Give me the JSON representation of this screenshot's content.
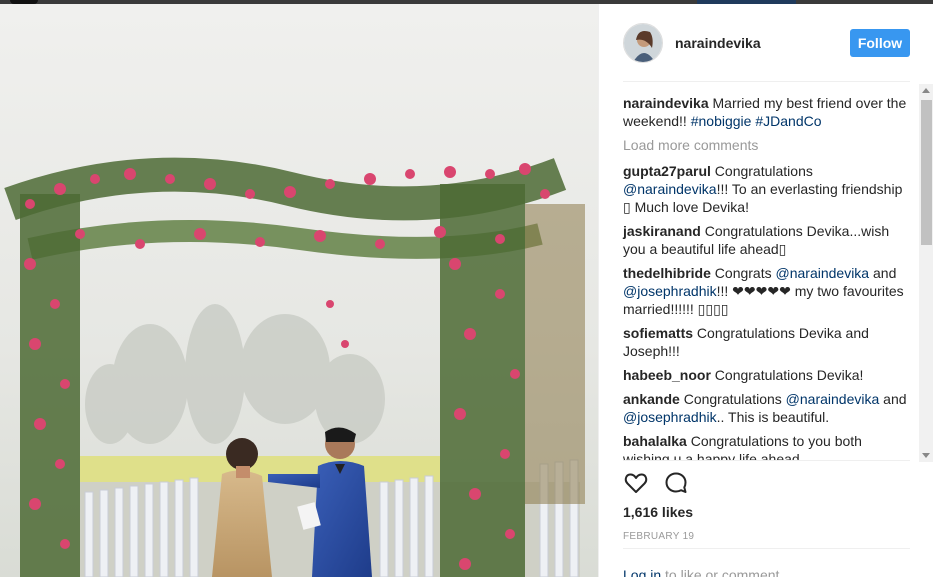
{
  "post": {
    "username": "naraindevika",
    "follow_label": "Follow",
    "caption_user": "naraindevika",
    "caption_text": " Married my best friend over the weekend!! ",
    "caption_tag1": "#nobiggie",
    "caption_tag2": "#JDandCo",
    "load_more": "Load more comments",
    "likes": "1,616 likes",
    "date": "FEBRUARY 19",
    "login_link": "Log in",
    "login_rest": " to like or comment.",
    "more_dots": "..."
  },
  "comments": [
    {
      "user": "gupta27parul",
      "parts": [
        " Congratulations ",
        "@naraindevika",
        "!!! To an everlasting friendship ▯ Much love Devika!"
      ]
    },
    {
      "user": "jaskiranand",
      "parts": [
        " Congratulations Devika...wish you a beautiful life ahead▯"
      ]
    },
    {
      "user": "thedelhibride",
      "parts": [
        " Congrats ",
        "@naraindevika",
        " and ",
        "@josephradhik",
        "!!! ❤❤❤❤❤ my two favourites married!!!!!! ▯▯▯▯"
      ]
    },
    {
      "user": "sofiematts",
      "parts": [
        " Congratulations Devika and Joseph!!!"
      ]
    },
    {
      "user": "habeeb_noor",
      "parts": [
        " Congratulations Devika!"
      ]
    },
    {
      "user": "ankande",
      "parts": [
        " Congratulations ",
        "@naraindevika",
        " and ",
        "@josephradhik",
        ".. This is beautiful."
      ]
    },
    {
      "user": "bahalalka",
      "parts": [
        " Congratulations to you both wishing u a happy life ahead"
      ]
    }
  ],
  "icons": {
    "like": "heart-icon",
    "comment": "comment-icon"
  },
  "colors": {
    "follow_button": "#3897f0",
    "link": "#003569",
    "muted": "#999999",
    "text": "#262626"
  }
}
